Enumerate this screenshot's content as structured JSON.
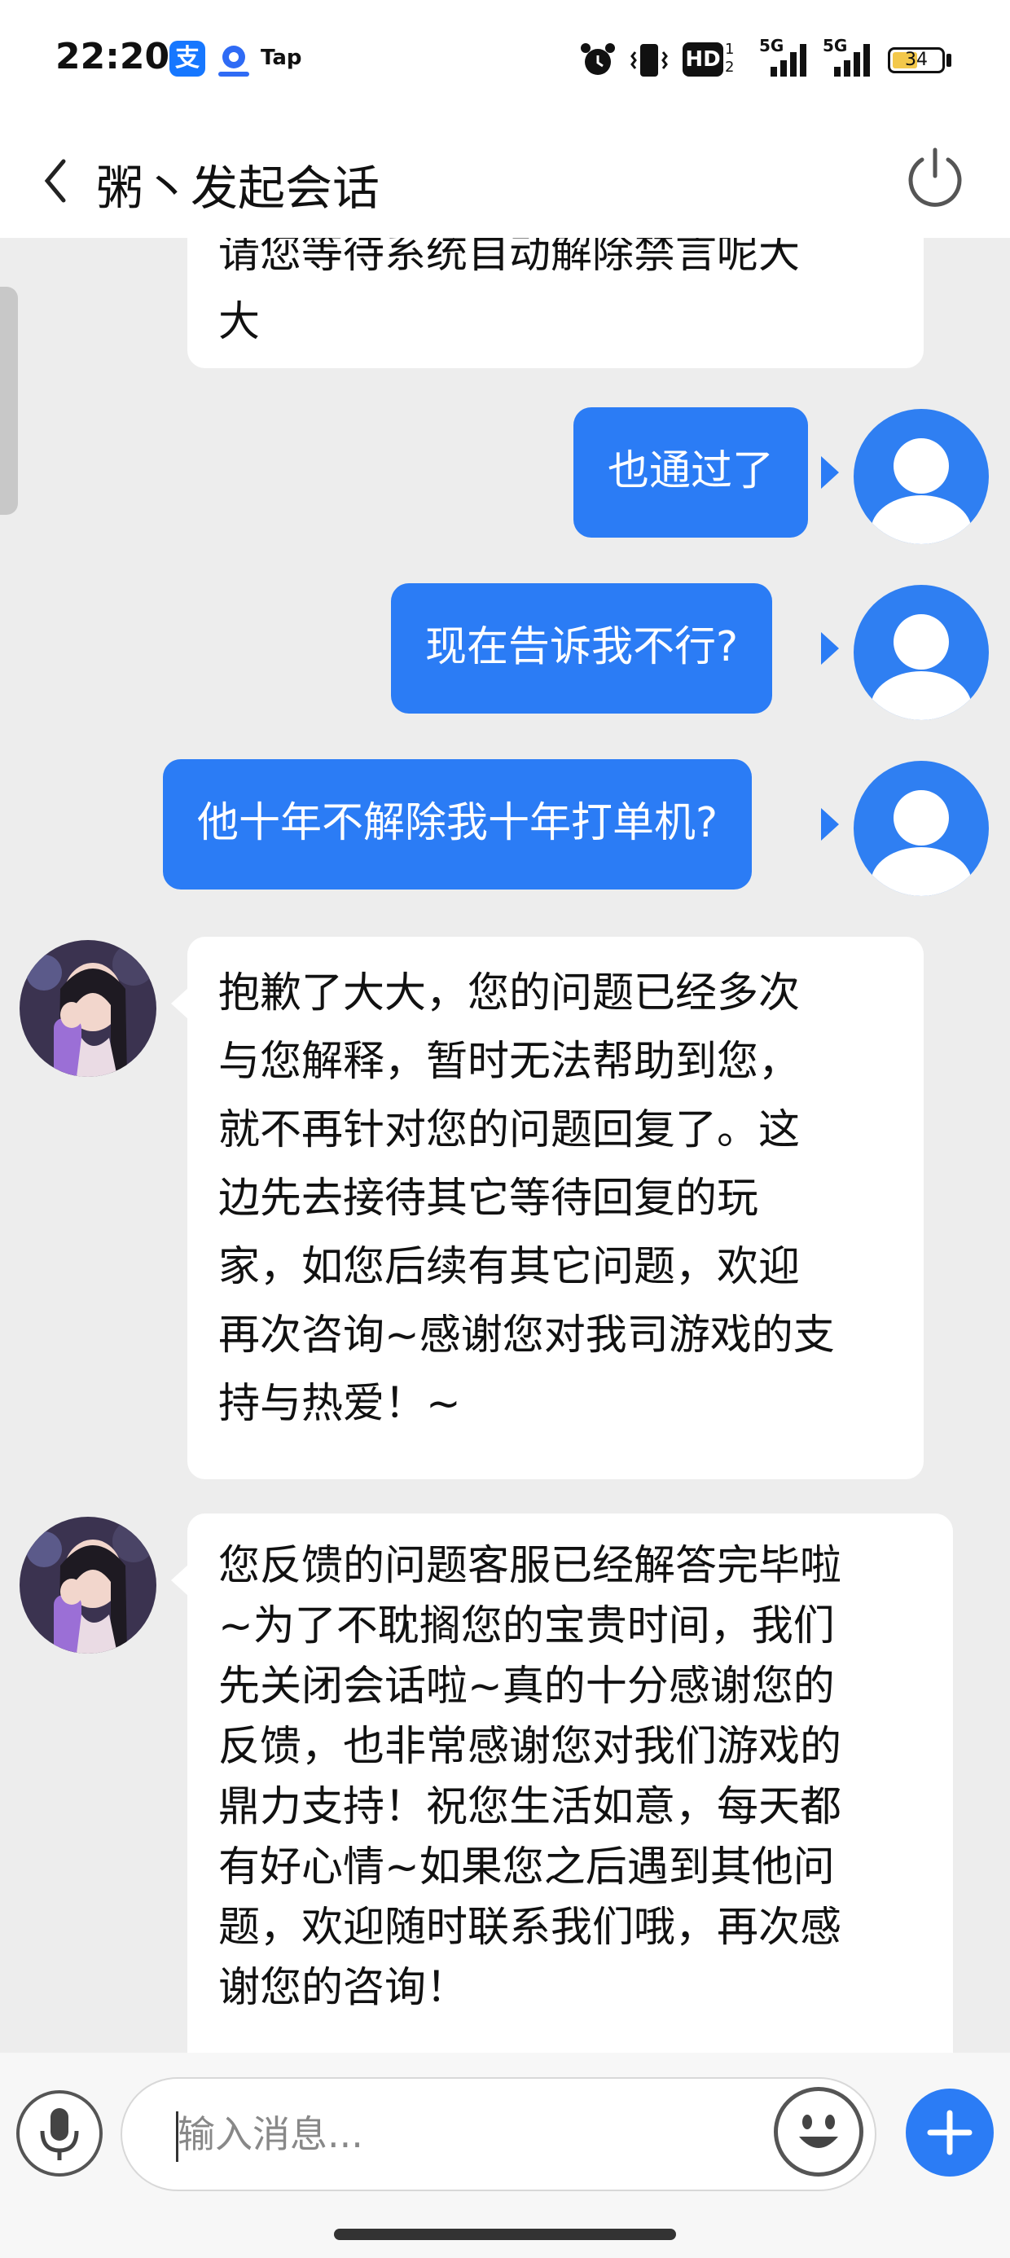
{
  "status_bar": {
    "time": "22:20",
    "apps": [
      {
        "name": "alipay-icon",
        "glyph": "支",
        "color": "#1677ff"
      },
      {
        "name": "baidu-wallet-icon",
        "glyph": "",
        "color": "#2f6bf5"
      }
    ],
    "tap_label": "Tap",
    "hd_label": "HD",
    "network": [
      "5G",
      "5G"
    ],
    "battery": "34"
  },
  "nav": {
    "title": "粥丶发起会话",
    "back_icon": "chevron-left-icon",
    "power_icon": "power-icon"
  },
  "messages": [
    {
      "side": "in",
      "partial": true,
      "lines": [
        "请您等待系统自动解除禁言呢大",
        "大"
      ]
    },
    {
      "side": "out",
      "text": "也通过了"
    },
    {
      "side": "out",
      "text": "现在告诉我不行?"
    },
    {
      "side": "out",
      "text": "他十年不解除我十年打单机?"
    },
    {
      "side": "in",
      "lines": [
        "抱歉了大大，您的问题已经多次",
        "与您解释，暂时无法帮助到您，",
        "就不再针对您的问题回复了。这",
        "边先去接待其它等待回复的玩",
        "家，如您后续有其它问题，欢迎",
        "再次咨询~感谢您对我司游戏的支",
        "持与热爱！~"
      ]
    },
    {
      "side": "in",
      "lines": [
        "您反馈的问题客服已经解答完毕啦",
        "~为了不耽搁您的宝贵时间，我们",
        "先关闭会话啦~真的十分感谢您的",
        "反馈，也非常感谢您对我们游戏的",
        "鼎力支持！祝您生活如意，每天都",
        "有好心情~如果您之后遇到其他问",
        "题，欢迎随时联系我们哦，再次感",
        "谢您的咨询！"
      ]
    }
  ],
  "input": {
    "placeholder": "输入消息..."
  },
  "colors": {
    "accent": "#2b7cf5",
    "background": "#ededed",
    "bubble_in": "#ffffff"
  }
}
